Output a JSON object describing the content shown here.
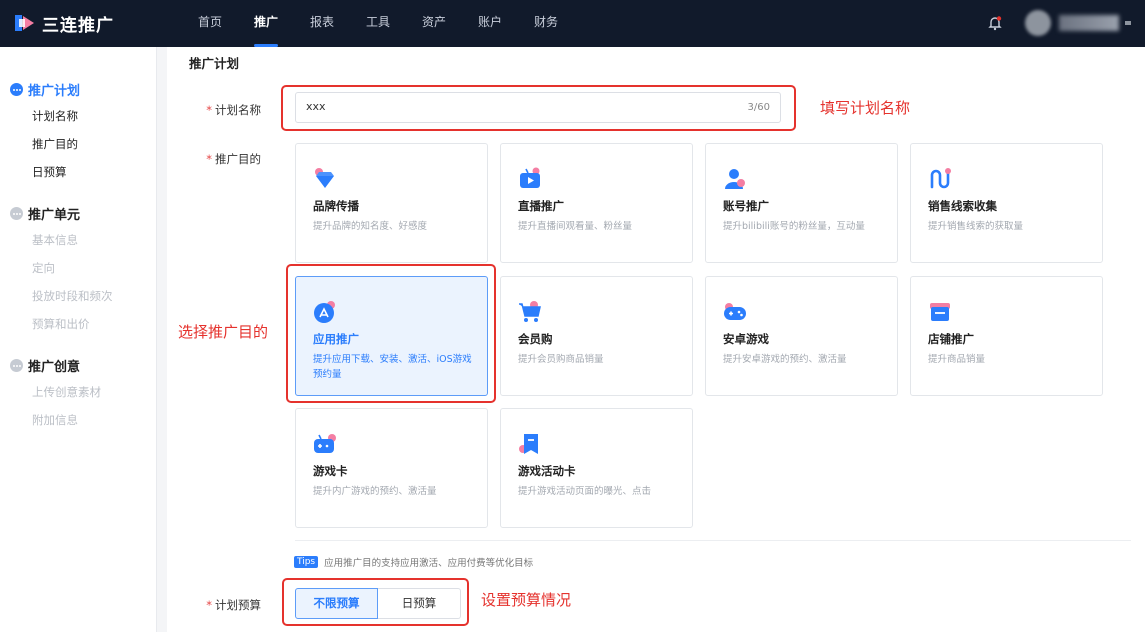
{
  "app": {
    "brand": "三连推广"
  },
  "nav": {
    "items": [
      "首页",
      "推广",
      "报表",
      "工具",
      "资产",
      "账户",
      "财务"
    ],
    "active_index": 1
  },
  "sidebar": {
    "sections": [
      {
        "title": "推广计划",
        "state": "active",
        "items": [
          "计划名称",
          "推广目的",
          "日预算"
        ]
      },
      {
        "title": "推广单元",
        "state": "inactive",
        "items": [
          "基本信息",
          "定向",
          "投放时段和频次",
          "预算和出价"
        ]
      },
      {
        "title": "推广创意",
        "state": "inactive",
        "items": [
          "上传创意素材",
          "附加信息"
        ]
      }
    ]
  },
  "form": {
    "section_title": "推广计划",
    "plan_name": {
      "label": "计划名称",
      "value": "xxx",
      "counter": "3/60"
    },
    "purpose": {
      "label": "推广目的",
      "selected_index": 4,
      "cards": [
        {
          "title": "品牌传播",
          "desc": "提升品牌的知名度、好感度",
          "icon": "diamond-icon"
        },
        {
          "title": "直播推广",
          "desc": "提升直播间观看量、粉丝量",
          "icon": "tv-play-icon"
        },
        {
          "title": "账号推广",
          "desc": "提升bilibili账号的粉丝量，互动量",
          "icon": "user-icon"
        },
        {
          "title": "销售线索收集",
          "desc": "提升销售线索的获取量",
          "icon": "funnel-path-icon"
        },
        {
          "title": "应用推广",
          "desc": "提升应用下载、安装、激活、iOS游戏预约量",
          "icon": "app-store-icon"
        },
        {
          "title": "会员购",
          "desc": "提升会员购商品销量",
          "icon": "shopping-cart-icon"
        },
        {
          "title": "安卓游戏",
          "desc": "提升安卓游戏的预约、激活量",
          "icon": "gamepad-icon"
        },
        {
          "title": "店铺推广",
          "desc": "提升商品销量",
          "icon": "shop-icon"
        },
        {
          "title": "游戏卡",
          "desc": "提升内广游戏的预约、激活量",
          "icon": "game-card-icon"
        },
        {
          "title": "游戏活动卡",
          "desc": "提升游戏活动页面的曝光、点击",
          "icon": "activity-card-icon"
        }
      ]
    },
    "tips": {
      "badge": "Tips",
      "text": "应用推广目的支持应用激活、应用付费等优化目标"
    },
    "budget": {
      "label": "计划预算",
      "options": [
        "不限预算",
        "日预算"
      ],
      "selected_index": 0
    }
  },
  "annotations": [
    "填写计划名称",
    "选择推广目的",
    "设置预算情况"
  ],
  "colors": {
    "accent": "#2b7dfc",
    "annotation_red": "#e5322d",
    "topbar": "#111a2b",
    "card_icon_pink": "#f47ea3"
  }
}
